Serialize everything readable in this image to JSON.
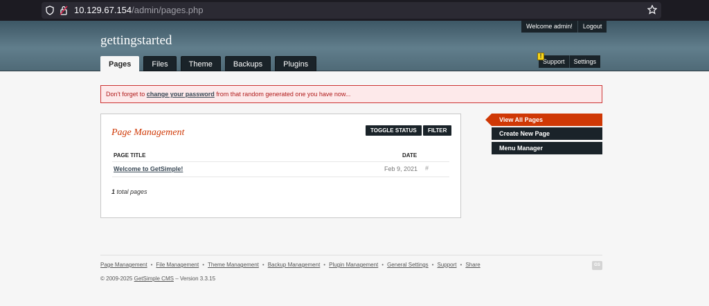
{
  "browser": {
    "url_host": "10.129.67.154",
    "url_path": "/admin/pages.php"
  },
  "header": {
    "site_name": "gettingstarted",
    "tabs": [
      {
        "label": "Pages",
        "active": true
      },
      {
        "label": "Files",
        "active": false
      },
      {
        "label": "Theme",
        "active": false
      },
      {
        "label": "Backups",
        "active": false
      },
      {
        "label": "Plugins",
        "active": false
      }
    ],
    "welcome": "Welcome admin!",
    "logout": "Logout",
    "support": "Support",
    "settings": "Settings",
    "alert_icon": "!"
  },
  "notice": {
    "before": "Don't forget to ",
    "link": "change your password",
    "after": " from that random generated one you have now..."
  },
  "panel": {
    "title": "Page Management",
    "toggle_status": "TOGGLE STATUS",
    "filter": "FILTER",
    "col_title": "PAGE TITLE",
    "col_date": "DATE",
    "rows": [
      {
        "title": "Welcome to GetSimple!",
        "date": "Feb 9, 2021",
        "hash": "#"
      }
    ],
    "total_count": "1",
    "total_suffix": " total pages"
  },
  "sidebar": {
    "items": [
      {
        "label": "View All Pages",
        "active": true
      },
      {
        "label": "Create New Page",
        "active": false
      },
      {
        "label": "Menu Manager",
        "active": false
      }
    ]
  },
  "footer": {
    "links": [
      "Page Management",
      "File Management",
      "Theme Management",
      "Backup Management",
      "Plugin Management",
      "General Settings",
      "Support",
      "Share"
    ],
    "separator": "•",
    "copyright_prefix": "© 2009-2025 ",
    "copyright_link": "GetSimple CMS",
    "copyright_suffix": " – Version 3.3.15",
    "logo_text": "GS"
  },
  "colors": {
    "accent": "#cf3805",
    "dark_button": "#1a2329",
    "header_top": "#3d5765"
  }
}
